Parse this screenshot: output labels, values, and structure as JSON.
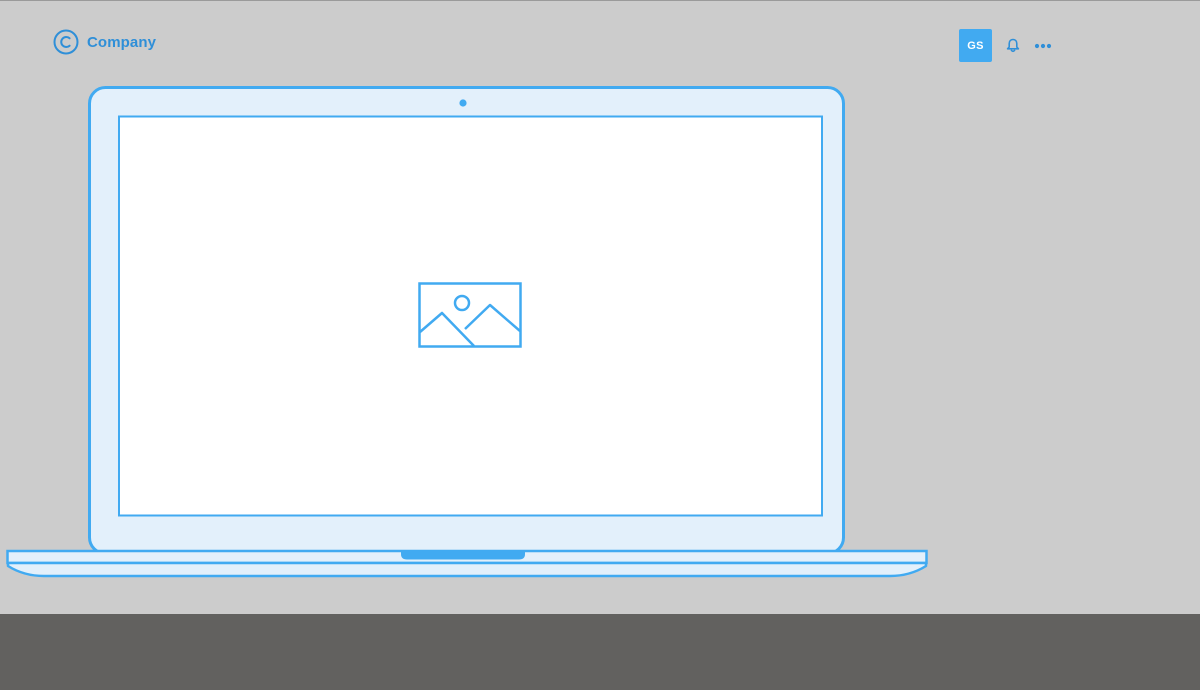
{
  "header": {
    "brand": {
      "logo_icon": "copyright-c-icon",
      "name": "Company"
    },
    "user": {
      "initials": "GS"
    },
    "icons": {
      "notifications": "bell-icon",
      "more": "more-horizontal-icon"
    }
  },
  "device": {
    "type": "laptop",
    "screen_content_icon": "image-placeholder-icon"
  },
  "colors": {
    "accent": "#41aaf1",
    "brand_text": "#2f8fd8",
    "device_frame": "#e3f0fb",
    "screen": "#ffffff",
    "page_background": "#cccccc",
    "footer_band": "#62615f"
  }
}
